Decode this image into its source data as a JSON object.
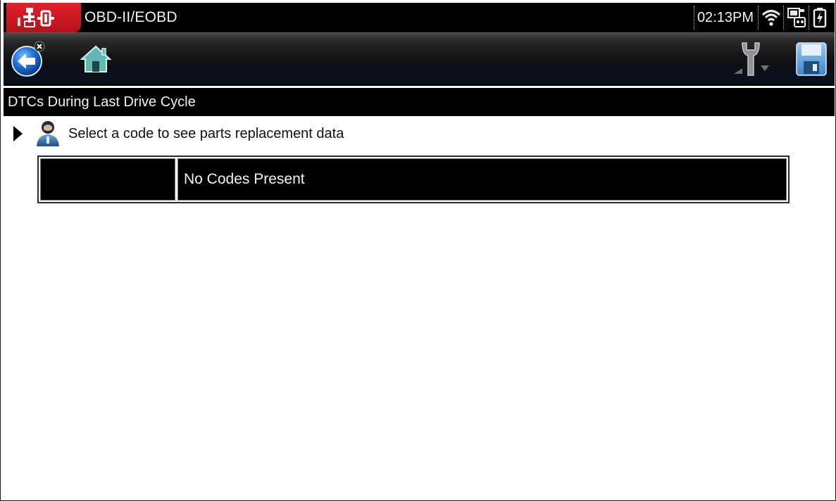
{
  "status_bar": {
    "title": "OBD-II/EOBD",
    "time": "02:13PM",
    "icons": [
      "vehicle-connection-icon",
      "wifi-icon",
      "network-icon",
      "battery-icon"
    ]
  },
  "toolbar": {
    "buttons": [
      "back-button",
      "home-button",
      "tools-button",
      "save-button"
    ]
  },
  "screen": {
    "title": "DTCs During Last Drive Cycle",
    "instruction": "Select a code to see parts replacement data"
  },
  "code_table": {
    "rows": [
      {
        "code": "",
        "description": "No Codes Present"
      }
    ]
  },
  "colors": {
    "badge_red": "#d01c25",
    "bar_black": "#000000",
    "button_blue": "#1f6ed4",
    "home_teal": "#4fa3a0"
  }
}
